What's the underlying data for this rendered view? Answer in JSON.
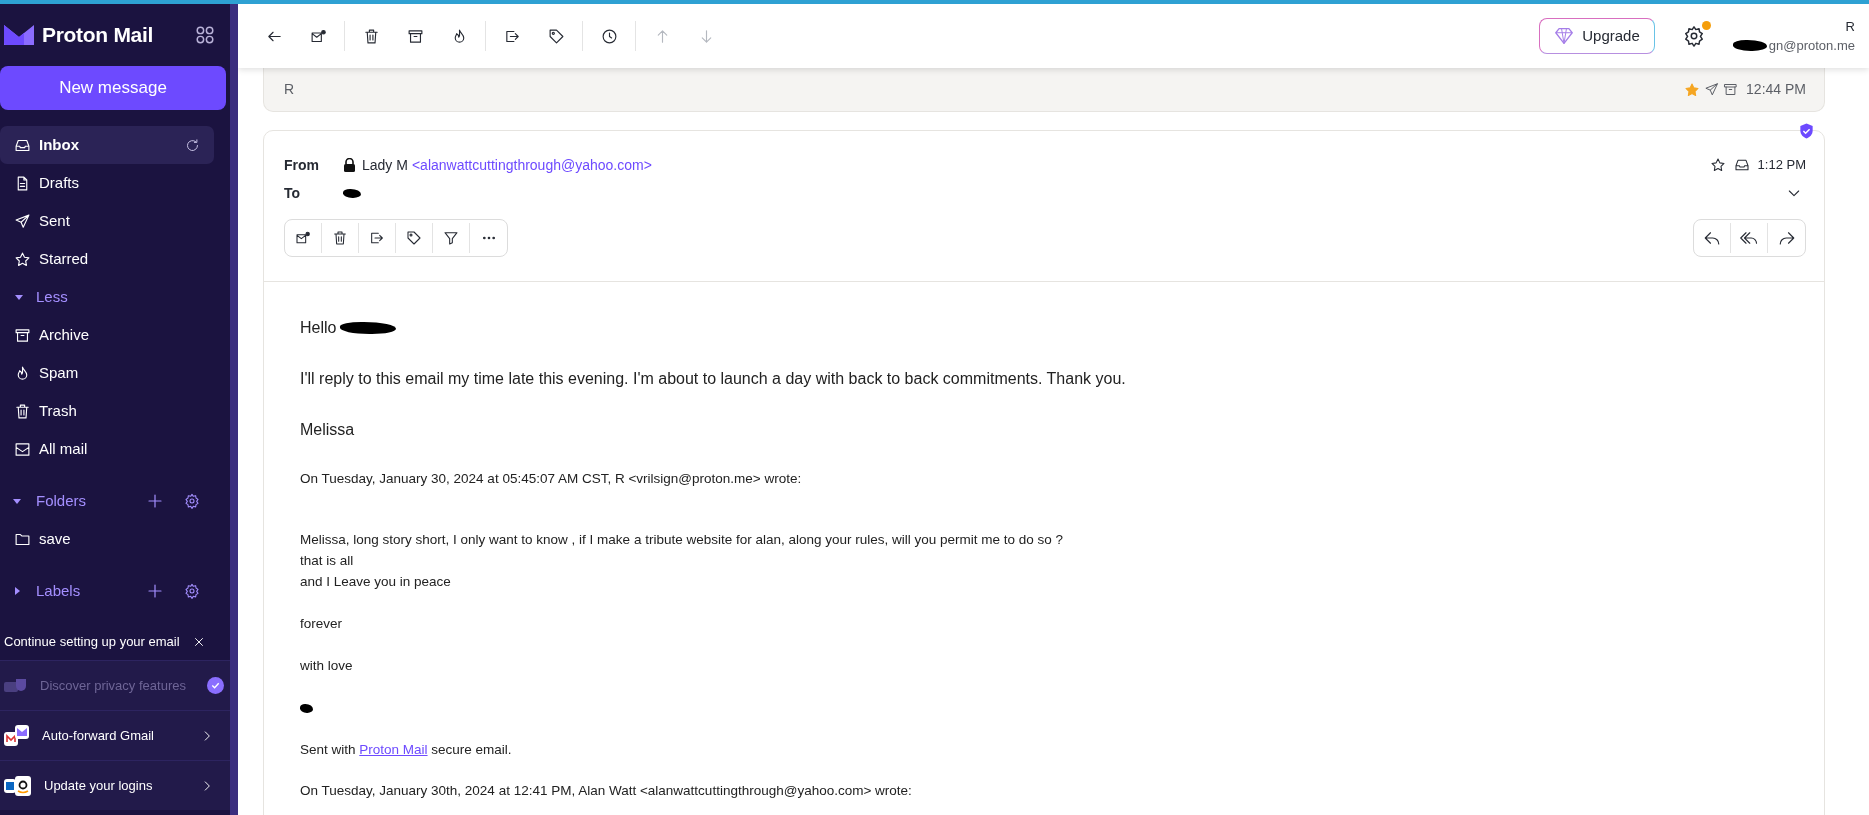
{
  "app": {
    "name": "Proton Mail"
  },
  "compose_button": "New message",
  "sidebar": {
    "items": [
      {
        "kind": "folder",
        "label": "Inbox",
        "selected": true,
        "refresh": true
      },
      {
        "kind": "folder",
        "label": "Drafts",
        "selected": false
      },
      {
        "kind": "folder",
        "label": "Sent",
        "selected": false
      },
      {
        "kind": "folder",
        "label": "Starred",
        "selected": false
      },
      {
        "kind": "toggle",
        "label": "Less",
        "expanded": true
      },
      {
        "kind": "folder",
        "label": "Archive",
        "selected": false
      },
      {
        "kind": "folder",
        "label": "Spam",
        "selected": false
      },
      {
        "kind": "folder",
        "label": "Trash",
        "selected": false
      },
      {
        "kind": "folder",
        "label": "All mail",
        "selected": false
      },
      {
        "kind": "section",
        "label": "Folders",
        "expanded": true,
        "children": [
          {
            "label": "save",
            "selected": false
          }
        ]
      },
      {
        "kind": "section",
        "label": "Labels",
        "expanded": false
      }
    ]
  },
  "onboarding": {
    "title": "Continue setting up your email",
    "items": [
      {
        "label": "Discover privacy features",
        "done": true
      },
      {
        "label": "Auto-forward Gmail",
        "done": false
      },
      {
        "label": "Update your logins",
        "done": false
      }
    ]
  },
  "toolbar": {
    "buttons": [
      {
        "disabled": false
      },
      {
        "disabled": false
      },
      {
        "disabled": false
      },
      {
        "disabled": false
      },
      {
        "disabled": false
      },
      {
        "disabled": false
      },
      {
        "disabled": false
      },
      {
        "disabled": false
      },
      {
        "disabled": true
      },
      {
        "disabled": true
      }
    ]
  },
  "upgrade_button": "Upgrade",
  "settings": {
    "notification": true
  },
  "user": {
    "name": "R",
    "email": "gn@proton.me",
    "redacted": true
  },
  "messages": [
    {
      "kind": "collapsed",
      "sender": "R",
      "starred": true,
      "time": "12:44 PM"
    },
    {
      "kind": "expanded",
      "from_label": "From",
      "sender_name": "Lady M",
      "sender_address": "<alanwattcuttingthrough@yahoo.com>",
      "to_label": "To",
      "to_redacted": true,
      "starred": false,
      "time": "1:12 PM",
      "verified": true,
      "body": [
        {
          "kind": "greeting",
          "text": "Hello",
          "redacted": true
        },
        {
          "kind": "para",
          "text": "I'll reply to this email my time late this evening.  I'm about to launch a day with back to back commitments.  Thank you."
        },
        {
          "kind": "para",
          "text": "Melissa"
        },
        {
          "kind": "quote_header",
          "text": "On Tuesday, January 30, 2024 at 05:45:07 AM CST, R <vrilsign@proton.me> wrote:"
        },
        {
          "kind": "small",
          "lines": [
            "Melissa, long story short, I only want to know , if I make a tribute website for alan, along your rules, will you permit me to do so ?",
            "that is all",
            "and I Leave you in peace"
          ]
        },
        {
          "kind": "small",
          "lines": [
            "forever"
          ]
        },
        {
          "kind": "small",
          "lines": [
            "with love"
          ]
        },
        {
          "kind": "redaction"
        },
        {
          "kind": "signature",
          "before": "Sent with ",
          "link": "Proton Mail",
          "after": " secure email."
        },
        {
          "kind": "quote_header",
          "text": "On Tuesday, January 30th, 2024 at 12:41 PM, Alan Watt <alanwattcuttingthrough@yahoo.com> wrote:"
        }
      ]
    }
  ]
}
